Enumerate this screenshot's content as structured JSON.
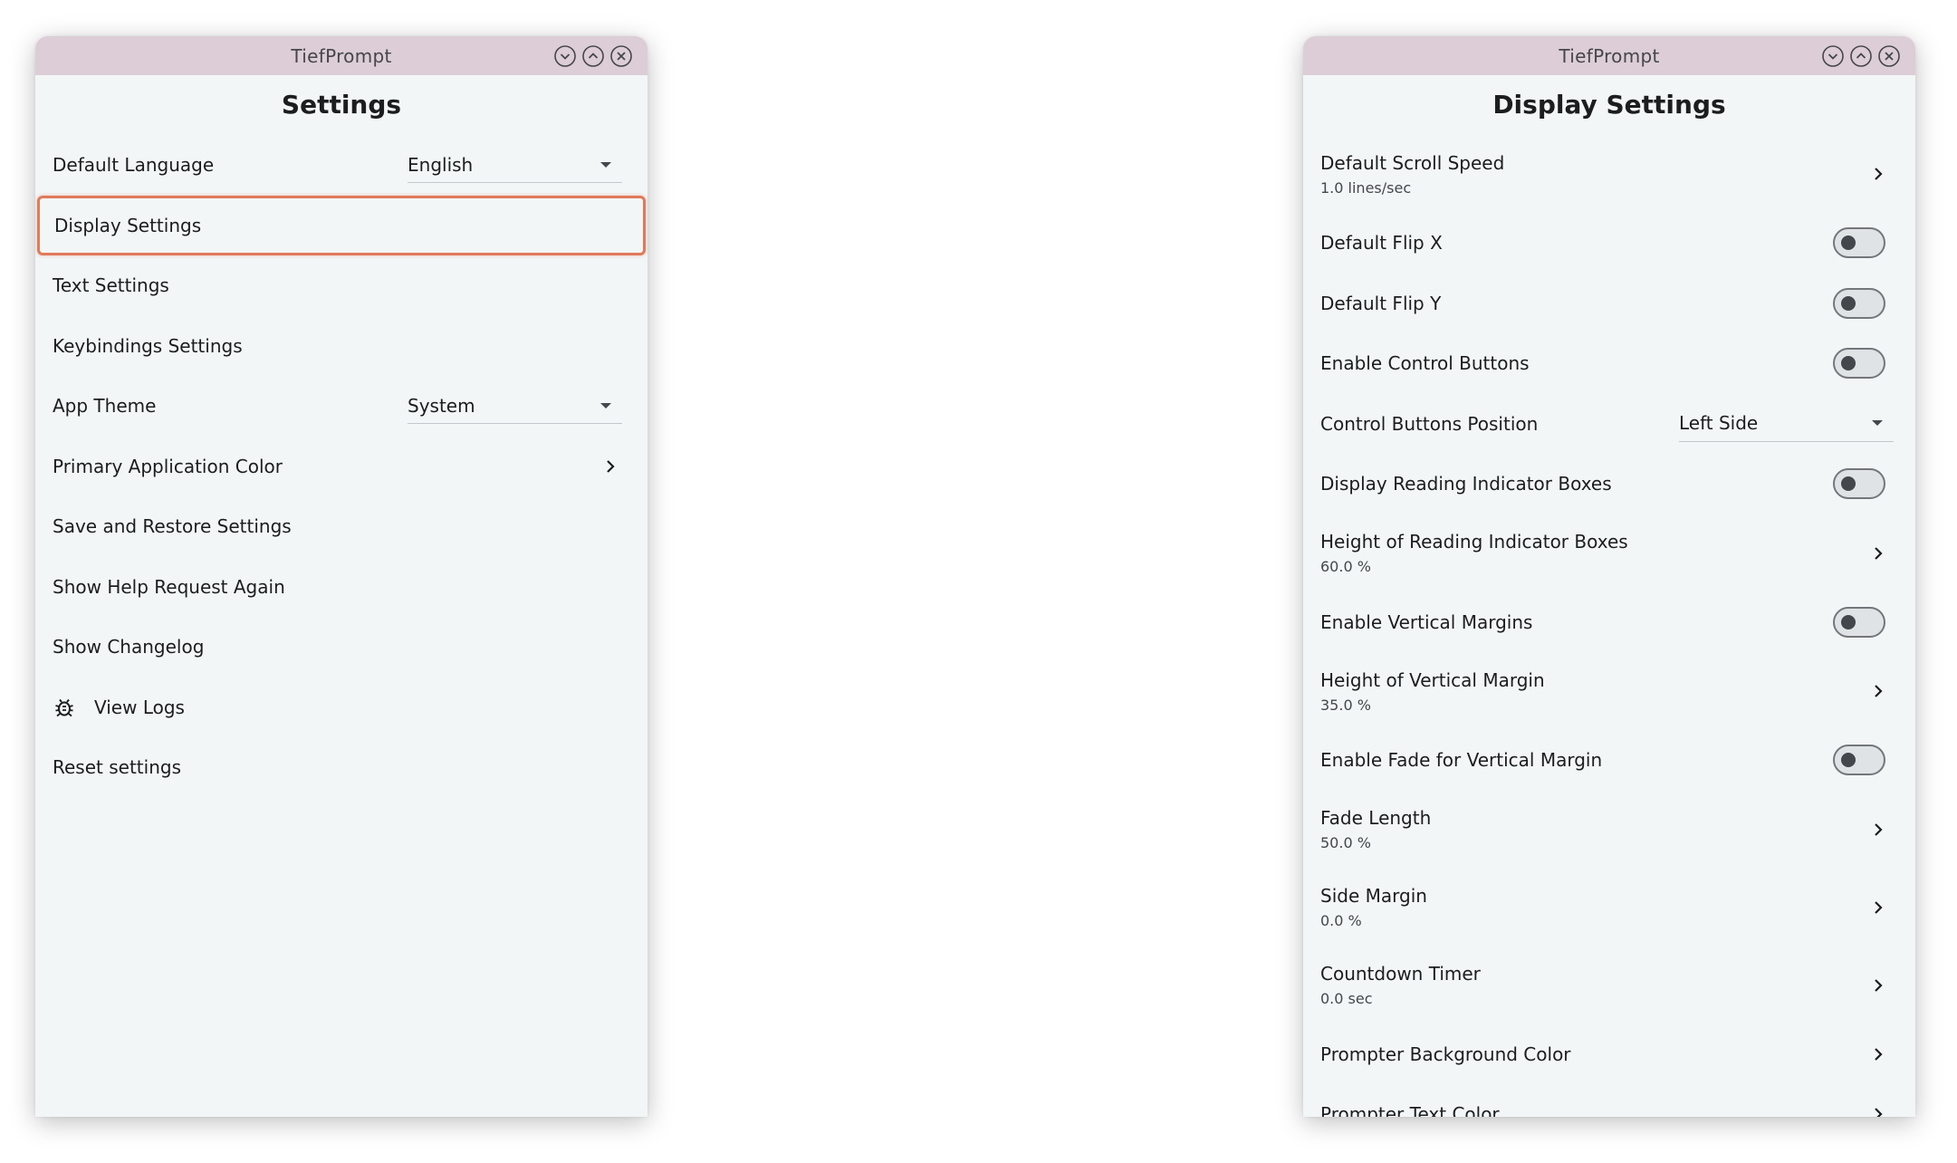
{
  "app_title": "TiefPrompt",
  "left": {
    "page_title": "Settings",
    "items": [
      {
        "label": "Default Language",
        "dropdown": "English"
      },
      {
        "label": "Display Settings"
      },
      {
        "label": "Text Settings"
      },
      {
        "label": "Keybindings Settings"
      },
      {
        "label": "App Theme",
        "dropdown": "System"
      },
      {
        "label": "Primary Application Color"
      },
      {
        "label": "Save and Restore Settings"
      },
      {
        "label": "Show Help Request Again"
      },
      {
        "label": "Show Changelog"
      },
      {
        "label": "View Logs",
        "icon": "bug-icon"
      },
      {
        "label": "Reset settings"
      }
    ]
  },
  "right": {
    "page_title": "Display Settings",
    "items": [
      {
        "label": "Default Scroll Speed",
        "sub": "1.0 lines/sec"
      },
      {
        "label": "Default Flip X",
        "toggle": false
      },
      {
        "label": "Default Flip Y",
        "toggle": false
      },
      {
        "label": "Enable Control Buttons",
        "toggle": false
      },
      {
        "label": "Control Buttons Position",
        "dropdown": "Left Side"
      },
      {
        "label": "Display Reading Indicator Boxes",
        "toggle": false
      },
      {
        "label": "Height of Reading Indicator Boxes",
        "sub": "60.0 %"
      },
      {
        "label": "Enable Vertical Margins",
        "toggle": false
      },
      {
        "label": "Height of Vertical Margin",
        "sub": "35.0 %"
      },
      {
        "label": "Enable Fade for Vertical Margin",
        "toggle": false
      },
      {
        "label": "Fade Length",
        "sub": "50.0 %"
      },
      {
        "label": "Side Margin",
        "sub": "0.0 %"
      },
      {
        "label": "Countdown Timer",
        "sub": "0.0 sec"
      },
      {
        "label": "Prompter Background Color"
      },
      {
        "label": "Prompter Text Color"
      }
    ]
  },
  "colors": {
    "titlebar": "#dccdd6",
    "window_bg": "#f3f6f7",
    "selection_border": "#e07a5a"
  }
}
